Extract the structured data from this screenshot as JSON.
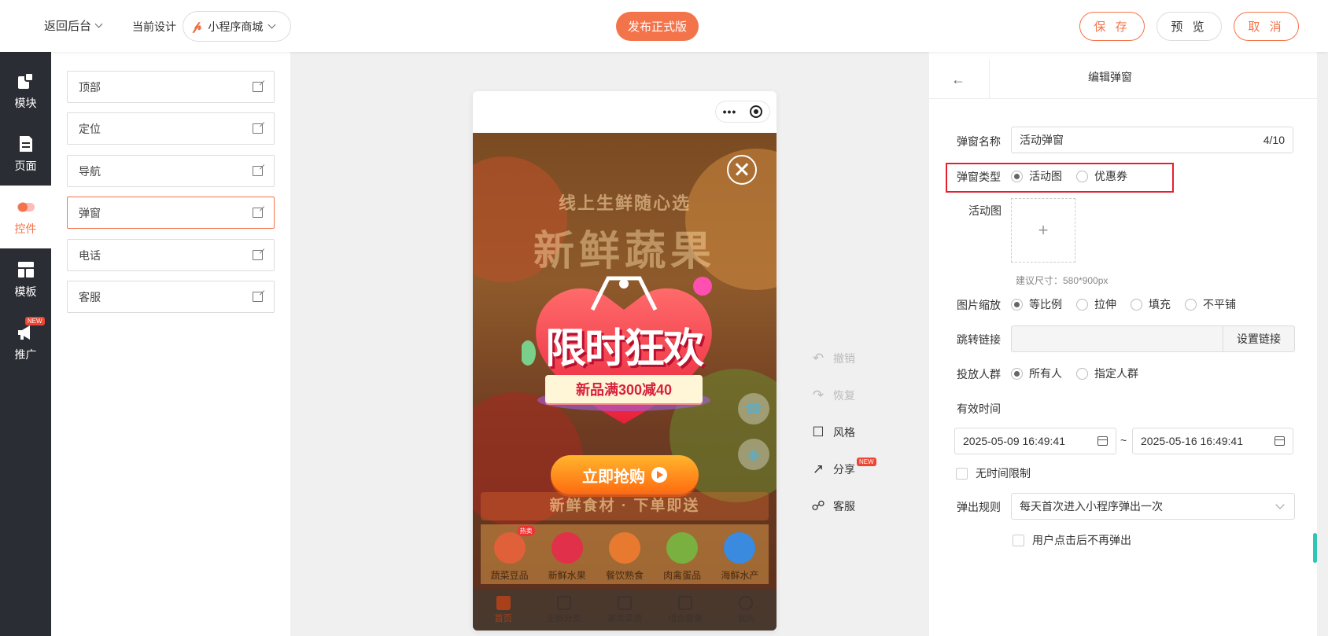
{
  "topbar": {
    "back_label": "返回后台",
    "current_design_label": "当前设计",
    "design_name": "小程序商城",
    "publish_label": "发布正式版",
    "save_label": "保 存",
    "preview_label": "预 览",
    "cancel_label": "取 消"
  },
  "left_nav": {
    "items": [
      {
        "label": "模块",
        "icon": "module-icon"
      },
      {
        "label": "页面",
        "icon": "page-icon"
      },
      {
        "label": "控件",
        "icon": "toggle-icon"
      },
      {
        "label": "模板",
        "icon": "template-icon"
      },
      {
        "label": "推广",
        "icon": "megaphone-icon",
        "badge": "NEW"
      }
    ],
    "active": "控件"
  },
  "components": {
    "items": [
      {
        "label": "顶部"
      },
      {
        "label": "定位"
      },
      {
        "label": "导航"
      },
      {
        "label": "弹窗"
      },
      {
        "label": "电话"
      },
      {
        "label": "客服"
      }
    ],
    "active": "弹窗"
  },
  "phone": {
    "bg_subtitle": "线上生鲜随心选",
    "bg_title": "新鲜蔬果",
    "promo_title": "限时狂欢",
    "promo_ribbon": "新品满300减40",
    "cta_label": "立即抢购",
    "bg_banner": "新鲜食材 · 下单即送",
    "categories": [
      {
        "label": "蔬菜豆品",
        "badge": "热卖",
        "color": "#e0603a"
      },
      {
        "label": "新鲜水果",
        "color": "#e0304a"
      },
      {
        "label": "餐饮熟食",
        "color": "#e87a30"
      },
      {
        "label": "肉禽蛋品",
        "color": "#7ab040"
      },
      {
        "label": "海鲜水产",
        "color": "#3a8ae0"
      }
    ],
    "tabs": [
      {
        "label": "首页"
      },
      {
        "label": "生鲜分类"
      },
      {
        "label": "家常菜谱"
      },
      {
        "label": "组合套餐"
      },
      {
        "label": "我的"
      }
    ],
    "active_tab": "首页"
  },
  "tools": {
    "undo": "撤销",
    "redo": "恢复",
    "style": "风格",
    "share": "分享",
    "share_badge": "NEW",
    "service": "客服"
  },
  "editor": {
    "title": "编辑弹窗",
    "name_label": "弹窗名称",
    "name_value": "活动弹窗",
    "name_count": "4/10",
    "type_label": "弹窗类型",
    "type_options": [
      "活动图",
      "优惠券"
    ],
    "type_selected": "活动图",
    "image_label": "活动图",
    "upload_symbol": "+",
    "size_hint": "建议尺寸：580*900px",
    "scale_label": "图片缩放",
    "scale_options": [
      "等比例",
      "拉伸",
      "填充",
      "不平铺"
    ],
    "scale_selected": "等比例",
    "link_label": "跳转链接",
    "link_value": "",
    "link_button": "设置链接",
    "audience_label": "投放人群",
    "audience_options": [
      "所有人",
      "指定人群"
    ],
    "audience_selected": "所有人",
    "valid_label": "有效时间",
    "start_time": "2025-05-09 16:49:41",
    "range_sep": "~",
    "end_time": "2025-05-16 16:49:41",
    "no_limit_label": "无时间限制",
    "rule_label": "弹出规则",
    "rule_value": "每天首次进入小程序弹出一次",
    "no_repeat_label": "用户点击后不再弹出"
  },
  "colors": {
    "accent": "#f3744a",
    "nav_bg": "#2a2d33",
    "highlight": "#e5202e"
  }
}
